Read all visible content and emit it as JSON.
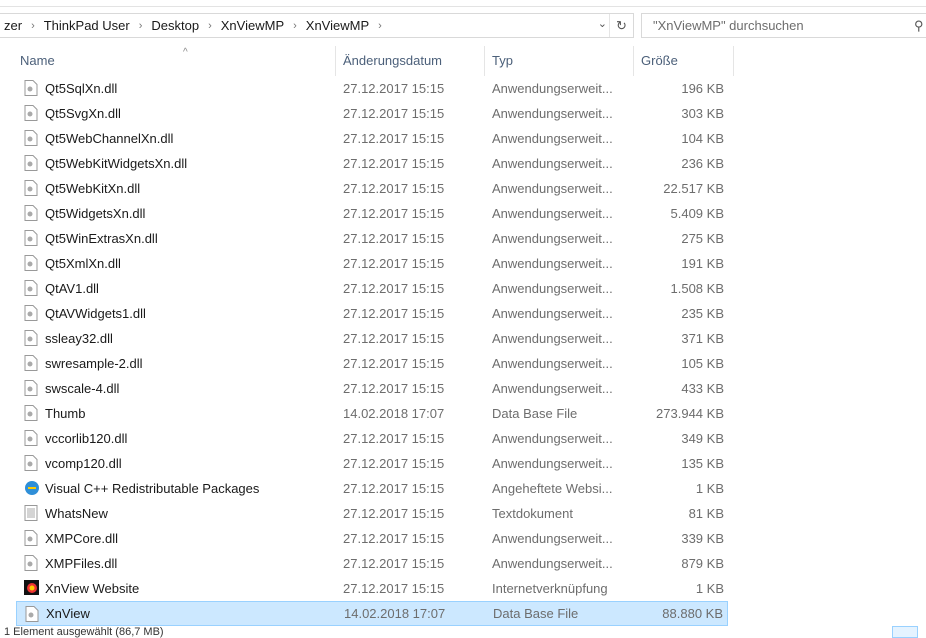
{
  "breadcrumb": [
    "zer",
    "ThinkPad User",
    "Desktop",
    "XnViewMP",
    "XnViewMP"
  ],
  "search": {
    "placeholder": "\"XnViewMP\" durchsuchen"
  },
  "columns": {
    "name": "Name",
    "date": "Änderungsdatum",
    "type": "Typ",
    "size": "Größe"
  },
  "files": [
    {
      "name": "Qt5SqlXn.dll",
      "date": "27.12.2017 15:15",
      "type": "Anwendungserweit...",
      "size": "196 KB",
      "icon": "dll"
    },
    {
      "name": "Qt5SvgXn.dll",
      "date": "27.12.2017 15:15",
      "type": "Anwendungserweit...",
      "size": "303 KB",
      "icon": "dll"
    },
    {
      "name": "Qt5WebChannelXn.dll",
      "date": "27.12.2017 15:15",
      "type": "Anwendungserweit...",
      "size": "104 KB",
      "icon": "dll"
    },
    {
      "name": "Qt5WebKitWidgetsXn.dll",
      "date": "27.12.2017 15:15",
      "type": "Anwendungserweit...",
      "size": "236 KB",
      "icon": "dll"
    },
    {
      "name": "Qt5WebKitXn.dll",
      "date": "27.12.2017 15:15",
      "type": "Anwendungserweit...",
      "size": "22.517 KB",
      "icon": "dll"
    },
    {
      "name": "Qt5WidgetsXn.dll",
      "date": "27.12.2017 15:15",
      "type": "Anwendungserweit...",
      "size": "5.409 KB",
      "icon": "dll"
    },
    {
      "name": "Qt5WinExtrasXn.dll",
      "date": "27.12.2017 15:15",
      "type": "Anwendungserweit...",
      "size": "275 KB",
      "icon": "dll"
    },
    {
      "name": "Qt5XmlXn.dll",
      "date": "27.12.2017 15:15",
      "type": "Anwendungserweit...",
      "size": "191 KB",
      "icon": "dll"
    },
    {
      "name": "QtAV1.dll",
      "date": "27.12.2017 15:15",
      "type": "Anwendungserweit...",
      "size": "1.508 KB",
      "icon": "dll"
    },
    {
      "name": "QtAVWidgets1.dll",
      "date": "27.12.2017 15:15",
      "type": "Anwendungserweit...",
      "size": "235 KB",
      "icon": "dll"
    },
    {
      "name": "ssleay32.dll",
      "date": "27.12.2017 15:15",
      "type": "Anwendungserweit...",
      "size": "371 KB",
      "icon": "dll"
    },
    {
      "name": "swresample-2.dll",
      "date": "27.12.2017 15:15",
      "type": "Anwendungserweit...",
      "size": "105 KB",
      "icon": "dll"
    },
    {
      "name": "swscale-4.dll",
      "date": "27.12.2017 15:15",
      "type": "Anwendungserweit...",
      "size": "433 KB",
      "icon": "dll"
    },
    {
      "name": "Thumb",
      "date": "14.02.2018 17:07",
      "type": "Data Base File",
      "size": "273.944 KB",
      "icon": "dll"
    },
    {
      "name": "vccorlib120.dll",
      "date": "27.12.2017 15:15",
      "type": "Anwendungserweit...",
      "size": "349 KB",
      "icon": "dll"
    },
    {
      "name": "vcomp120.dll",
      "date": "27.12.2017 15:15",
      "type": "Anwendungserweit...",
      "size": "135 KB",
      "icon": "dll"
    },
    {
      "name": "Visual C++ Redistributable Packages",
      "date": "27.12.2017 15:15",
      "type": "Angeheftete Websi...",
      "size": "1 KB",
      "icon": "web"
    },
    {
      "name": "WhatsNew",
      "date": "27.12.2017 15:15",
      "type": "Textdokument",
      "size": "81 KB",
      "icon": "txt"
    },
    {
      "name": "XMPCore.dll",
      "date": "27.12.2017 15:15",
      "type": "Anwendungserweit...",
      "size": "339 KB",
      "icon": "dll"
    },
    {
      "name": "XMPFiles.dll",
      "date": "27.12.2017 15:15",
      "type": "Anwendungserweit...",
      "size": "879 KB",
      "icon": "dll"
    },
    {
      "name": "XnView Website",
      "date": "27.12.2017 15:15",
      "type": "Internetverknüpfung",
      "size": "1 KB",
      "icon": "xn"
    },
    {
      "name": "XnView",
      "date": "14.02.2018 17:07",
      "type": "Data Base File",
      "size": "88.880 KB",
      "icon": "dll",
      "selected": true
    }
  ],
  "status": "1 Element ausgewählt (86,7 MB)"
}
